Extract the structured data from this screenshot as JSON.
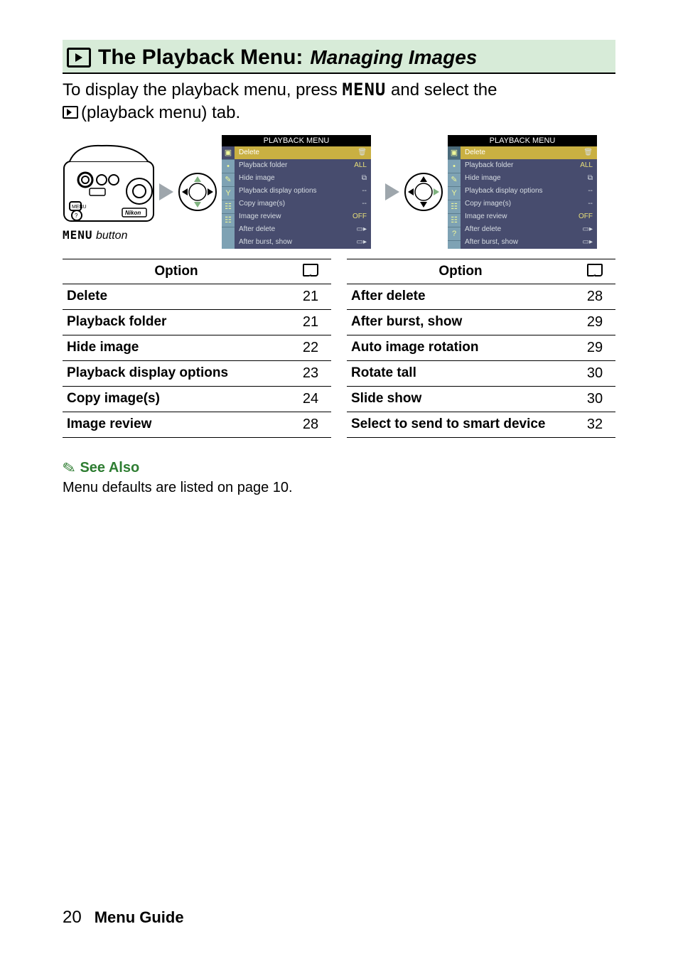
{
  "header": {
    "title_strong": "The Playback Menu:",
    "title_em": "Managing Images"
  },
  "intro": {
    "line1_a": "To display the playback menu, press ",
    "menu_word": "MENU",
    "line1_b": " and select the ",
    "line2": "(playback menu) tab."
  },
  "figure": {
    "button_menu": "MENU",
    "button_word": "button",
    "screen_title": "PLAYBACK MENU",
    "items": [
      {
        "label": "Delete",
        "value": "🗑"
      },
      {
        "label": "Playback folder",
        "value": "ALL"
      },
      {
        "label": "Hide image",
        "value": "⧉"
      },
      {
        "label": "Playback display options",
        "value": "--"
      },
      {
        "label": "Copy image(s)",
        "value": "--"
      },
      {
        "label": "Image review",
        "value": "OFF"
      },
      {
        "label": "After delete",
        "value": "▭▸"
      },
      {
        "label": "After burst, show",
        "value": "▭▸"
      }
    ],
    "tabs": [
      "▣",
      "•",
      "✎",
      "Y",
      "☷",
      "☷",
      "?"
    ]
  },
  "tables": {
    "col_option": "Option",
    "left": [
      {
        "opt": "Delete",
        "pg": "21"
      },
      {
        "opt": "Playback folder",
        "pg": "21"
      },
      {
        "opt": "Hide image",
        "pg": "22"
      },
      {
        "opt": "Playback display options",
        "pg": "23"
      },
      {
        "opt": "Copy image(s)",
        "pg": "24"
      },
      {
        "opt": "Image review",
        "pg": "28"
      }
    ],
    "right": [
      {
        "opt": "After delete",
        "pg": "28"
      },
      {
        "opt": "After burst, show",
        "pg": "29"
      },
      {
        "opt": "Auto image rotation",
        "pg": "29"
      },
      {
        "opt": "Rotate tall",
        "pg": "30"
      },
      {
        "opt": "Slide show",
        "pg": "30"
      },
      {
        "opt": "Select to send to smart device",
        "pg": "32"
      }
    ]
  },
  "seealso": {
    "label": "See Also",
    "body": "Menu defaults are listed on page 10."
  },
  "footer": {
    "page": "20",
    "section": "Menu Guide"
  }
}
